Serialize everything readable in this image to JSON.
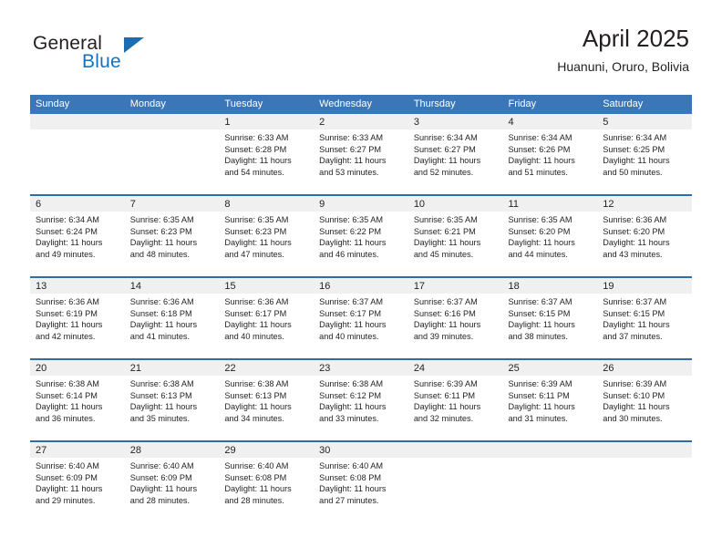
{
  "brand": {
    "name_part1": "General",
    "name_part2": "Blue",
    "accent_color": "#1273c4",
    "triangle_color": "#1b6cb0"
  },
  "header": {
    "title": "April 2025",
    "subtitle": "Huanuni, Oruro, Bolivia"
  },
  "theme": {
    "header_blue": "#3a76b8",
    "row_rule_blue": "#2e6da4",
    "day_band_gray": "#f0f0f0"
  },
  "columns": [
    "Sunday",
    "Monday",
    "Tuesday",
    "Wednesday",
    "Thursday",
    "Friday",
    "Saturday"
  ],
  "weeks": [
    [
      {
        "day": "",
        "empty": true
      },
      {
        "day": "",
        "empty": true
      },
      {
        "day": "1",
        "sunrise": "Sunrise: 6:33 AM",
        "sunset": "Sunset: 6:28 PM",
        "daylight_l1": "Daylight: 11 hours",
        "daylight_l2": "and 54 minutes."
      },
      {
        "day": "2",
        "sunrise": "Sunrise: 6:33 AM",
        "sunset": "Sunset: 6:27 PM",
        "daylight_l1": "Daylight: 11 hours",
        "daylight_l2": "and 53 minutes."
      },
      {
        "day": "3",
        "sunrise": "Sunrise: 6:34 AM",
        "sunset": "Sunset: 6:27 PM",
        "daylight_l1": "Daylight: 11 hours",
        "daylight_l2": "and 52 minutes."
      },
      {
        "day": "4",
        "sunrise": "Sunrise: 6:34 AM",
        "sunset": "Sunset: 6:26 PM",
        "daylight_l1": "Daylight: 11 hours",
        "daylight_l2": "and 51 minutes."
      },
      {
        "day": "5",
        "sunrise": "Sunrise: 6:34 AM",
        "sunset": "Sunset: 6:25 PM",
        "daylight_l1": "Daylight: 11 hours",
        "daylight_l2": "and 50 minutes."
      }
    ],
    [
      {
        "day": "6",
        "sunrise": "Sunrise: 6:34 AM",
        "sunset": "Sunset: 6:24 PM",
        "daylight_l1": "Daylight: 11 hours",
        "daylight_l2": "and 49 minutes."
      },
      {
        "day": "7",
        "sunrise": "Sunrise: 6:35 AM",
        "sunset": "Sunset: 6:23 PM",
        "daylight_l1": "Daylight: 11 hours",
        "daylight_l2": "and 48 minutes."
      },
      {
        "day": "8",
        "sunrise": "Sunrise: 6:35 AM",
        "sunset": "Sunset: 6:23 PM",
        "daylight_l1": "Daylight: 11 hours",
        "daylight_l2": "and 47 minutes."
      },
      {
        "day": "9",
        "sunrise": "Sunrise: 6:35 AM",
        "sunset": "Sunset: 6:22 PM",
        "daylight_l1": "Daylight: 11 hours",
        "daylight_l2": "and 46 minutes."
      },
      {
        "day": "10",
        "sunrise": "Sunrise: 6:35 AM",
        "sunset": "Sunset: 6:21 PM",
        "daylight_l1": "Daylight: 11 hours",
        "daylight_l2": "and 45 minutes."
      },
      {
        "day": "11",
        "sunrise": "Sunrise: 6:35 AM",
        "sunset": "Sunset: 6:20 PM",
        "daylight_l1": "Daylight: 11 hours",
        "daylight_l2": "and 44 minutes."
      },
      {
        "day": "12",
        "sunrise": "Sunrise: 6:36 AM",
        "sunset": "Sunset: 6:20 PM",
        "daylight_l1": "Daylight: 11 hours",
        "daylight_l2": "and 43 minutes."
      }
    ],
    [
      {
        "day": "13",
        "sunrise": "Sunrise: 6:36 AM",
        "sunset": "Sunset: 6:19 PM",
        "daylight_l1": "Daylight: 11 hours",
        "daylight_l2": "and 42 minutes."
      },
      {
        "day": "14",
        "sunrise": "Sunrise: 6:36 AM",
        "sunset": "Sunset: 6:18 PM",
        "daylight_l1": "Daylight: 11 hours",
        "daylight_l2": "and 41 minutes."
      },
      {
        "day": "15",
        "sunrise": "Sunrise: 6:36 AM",
        "sunset": "Sunset: 6:17 PM",
        "daylight_l1": "Daylight: 11 hours",
        "daylight_l2": "and 40 minutes."
      },
      {
        "day": "16",
        "sunrise": "Sunrise: 6:37 AM",
        "sunset": "Sunset: 6:17 PM",
        "daylight_l1": "Daylight: 11 hours",
        "daylight_l2": "and 40 minutes."
      },
      {
        "day": "17",
        "sunrise": "Sunrise: 6:37 AM",
        "sunset": "Sunset: 6:16 PM",
        "daylight_l1": "Daylight: 11 hours",
        "daylight_l2": "and 39 minutes."
      },
      {
        "day": "18",
        "sunrise": "Sunrise: 6:37 AM",
        "sunset": "Sunset: 6:15 PM",
        "daylight_l1": "Daylight: 11 hours",
        "daylight_l2": "and 38 minutes."
      },
      {
        "day": "19",
        "sunrise": "Sunrise: 6:37 AM",
        "sunset": "Sunset: 6:15 PM",
        "daylight_l1": "Daylight: 11 hours",
        "daylight_l2": "and 37 minutes."
      }
    ],
    [
      {
        "day": "20",
        "sunrise": "Sunrise: 6:38 AM",
        "sunset": "Sunset: 6:14 PM",
        "daylight_l1": "Daylight: 11 hours",
        "daylight_l2": "and 36 minutes."
      },
      {
        "day": "21",
        "sunrise": "Sunrise: 6:38 AM",
        "sunset": "Sunset: 6:13 PM",
        "daylight_l1": "Daylight: 11 hours",
        "daylight_l2": "and 35 minutes."
      },
      {
        "day": "22",
        "sunrise": "Sunrise: 6:38 AM",
        "sunset": "Sunset: 6:13 PM",
        "daylight_l1": "Daylight: 11 hours",
        "daylight_l2": "and 34 minutes."
      },
      {
        "day": "23",
        "sunrise": "Sunrise: 6:38 AM",
        "sunset": "Sunset: 6:12 PM",
        "daylight_l1": "Daylight: 11 hours",
        "daylight_l2": "and 33 minutes."
      },
      {
        "day": "24",
        "sunrise": "Sunrise: 6:39 AM",
        "sunset": "Sunset: 6:11 PM",
        "daylight_l1": "Daylight: 11 hours",
        "daylight_l2": "and 32 minutes."
      },
      {
        "day": "25",
        "sunrise": "Sunrise: 6:39 AM",
        "sunset": "Sunset: 6:11 PM",
        "daylight_l1": "Daylight: 11 hours",
        "daylight_l2": "and 31 minutes."
      },
      {
        "day": "26",
        "sunrise": "Sunrise: 6:39 AM",
        "sunset": "Sunset: 6:10 PM",
        "daylight_l1": "Daylight: 11 hours",
        "daylight_l2": "and 30 minutes."
      }
    ],
    [
      {
        "day": "27",
        "sunrise": "Sunrise: 6:40 AM",
        "sunset": "Sunset: 6:09 PM",
        "daylight_l1": "Daylight: 11 hours",
        "daylight_l2": "and 29 minutes."
      },
      {
        "day": "28",
        "sunrise": "Sunrise: 6:40 AM",
        "sunset": "Sunset: 6:09 PM",
        "daylight_l1": "Daylight: 11 hours",
        "daylight_l2": "and 28 minutes."
      },
      {
        "day": "29",
        "sunrise": "Sunrise: 6:40 AM",
        "sunset": "Sunset: 6:08 PM",
        "daylight_l1": "Daylight: 11 hours",
        "daylight_l2": "and 28 minutes."
      },
      {
        "day": "30",
        "sunrise": "Sunrise: 6:40 AM",
        "sunset": "Sunset: 6:08 PM",
        "daylight_l1": "Daylight: 11 hours",
        "daylight_l2": "and 27 minutes."
      },
      {
        "day": "",
        "empty": true
      },
      {
        "day": "",
        "empty": true
      },
      {
        "day": "",
        "empty": true
      }
    ]
  ]
}
